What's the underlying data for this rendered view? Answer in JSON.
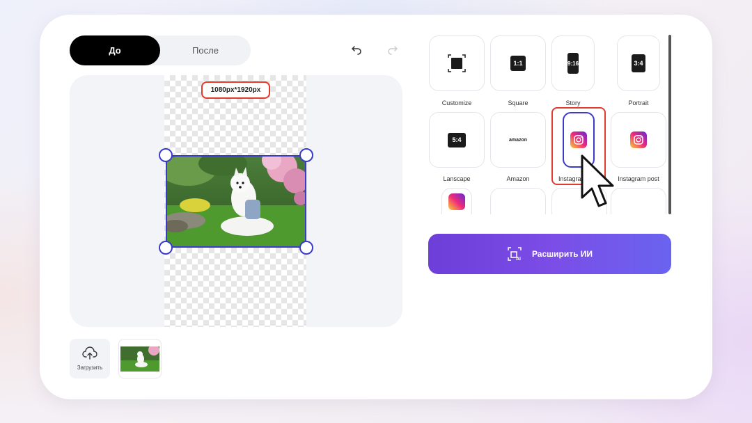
{
  "toggle": {
    "before_label": "До",
    "after_label": "После",
    "active": "before"
  },
  "toolbar": {
    "undo_icon": "undo-icon",
    "redo_icon": "redo-icon"
  },
  "canvas": {
    "size_label": "1080px*1920px"
  },
  "upload": {
    "label": "Загрузить",
    "icon": "cloud-upload-icon"
  },
  "presets": [
    {
      "id": "customize",
      "label": "Customize",
      "glyph": ""
    },
    {
      "id": "square",
      "label": "Square",
      "glyph": "1:1"
    },
    {
      "id": "story",
      "label": "Story",
      "glyph": "9:16"
    },
    {
      "id": "portrait",
      "label": "Portrait",
      "glyph": "3:4"
    },
    {
      "id": "landscape",
      "label": "Lanscape",
      "glyph": "5:4"
    },
    {
      "id": "amazon",
      "label": "Amazon",
      "glyph": "amazon"
    },
    {
      "id": "instagram",
      "label": "Instagram",
      "glyph": ""
    },
    {
      "id": "instagram-post",
      "label": "Instagram post",
      "glyph": ""
    }
  ],
  "expand_button": {
    "label": "Расширить ИИ"
  },
  "colors": {
    "accent": "#6d3ed8",
    "selection": "#3a3acb",
    "highlight": "#e23a2d"
  }
}
